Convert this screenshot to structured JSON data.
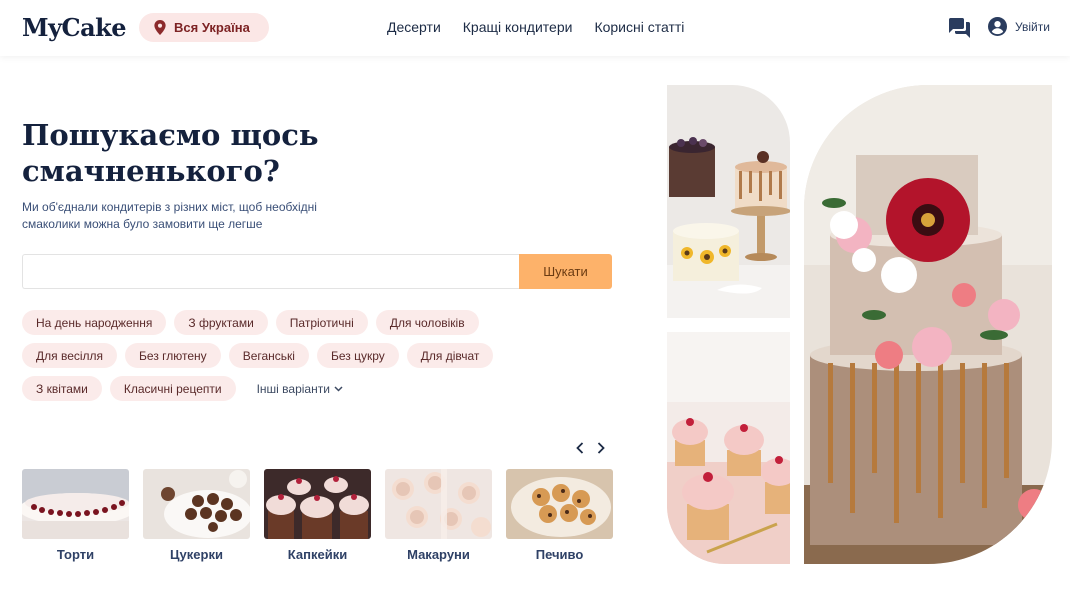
{
  "header": {
    "logo": "MyCake",
    "location": "Вся Україна",
    "nav": [
      "Десерти",
      "Кращі кондитери",
      "Корисні статті"
    ],
    "login": "Увійти",
    "icons": {
      "location": "location-pin-icon",
      "messages": "chat-icon",
      "account": "user-circle-icon"
    }
  },
  "hero": {
    "title": "Пошукаємо щось смачненького?",
    "subtitle": "Ми об'єднали кондитерів з різних міст, щоб необхідні смаколики можна було замовити ще легше"
  },
  "search": {
    "value": "",
    "placeholder": "",
    "button": "Шукати"
  },
  "tags": [
    "На день народження",
    "З фруктами",
    "Патріотичні",
    "Для чоловіків",
    "Для весілля",
    "Без глютену",
    "Веганські",
    "Без цукру",
    "Для дівчат",
    "З квітами",
    "Класичні рецепти"
  ],
  "more_tags": "Інші варіанти",
  "categories": [
    "Торти",
    "Цукерки",
    "Капкейки",
    "Макаруни",
    "Печиво"
  ],
  "colors": {
    "accent": "#fdb26a",
    "tag_bg": "#fbebea",
    "navy": "#14213d",
    "location_bg": "#fbe7e6"
  }
}
